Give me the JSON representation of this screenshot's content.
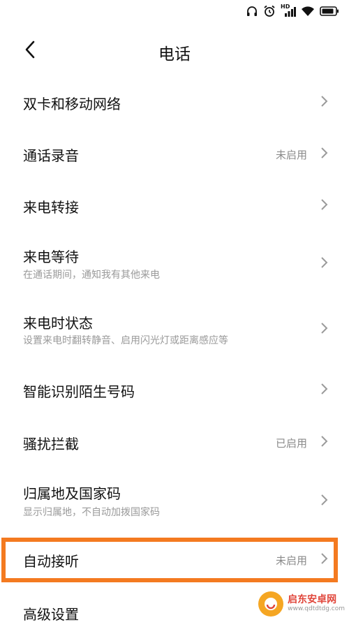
{
  "status_bar": {
    "icons": [
      "headphones-icon",
      "alarm-icon",
      "hd-signal-icon",
      "wifi-icon",
      "battery-icon"
    ],
    "hd_label": "HD"
  },
  "header": {
    "back_icon": "chevron-left-icon",
    "title": "电话"
  },
  "settings": [
    {
      "label": "双卡和移动网络",
      "sub": "",
      "value": ""
    },
    {
      "label": "通话录音",
      "sub": "",
      "value": "未启用"
    },
    {
      "label": "来电转接",
      "sub": "",
      "value": ""
    },
    {
      "label": "来电等待",
      "sub": "在通话期间，通知我有其他来电",
      "value": ""
    },
    {
      "label": "来电时状态",
      "sub": "设置来电时翻转静音、启用闪光灯或距离感应等",
      "value": ""
    },
    {
      "label": "智能识别陌生号码",
      "sub": "",
      "value": ""
    },
    {
      "label": "骚扰拦截",
      "sub": "",
      "value": "已启用"
    },
    {
      "label": "归属地及国家码",
      "sub": "显示归属地，不自动加拨国家码",
      "value": ""
    },
    {
      "label": "自动接听",
      "sub": "",
      "value": "未启用"
    },
    {
      "label": "高级设置",
      "sub": "",
      "value": ""
    }
  ],
  "highlight": {
    "color": "#f47a20",
    "target": "自动接听"
  },
  "watermark": {
    "name": "启东安卓网",
    "url": "www.qdtdtdg.com"
  }
}
